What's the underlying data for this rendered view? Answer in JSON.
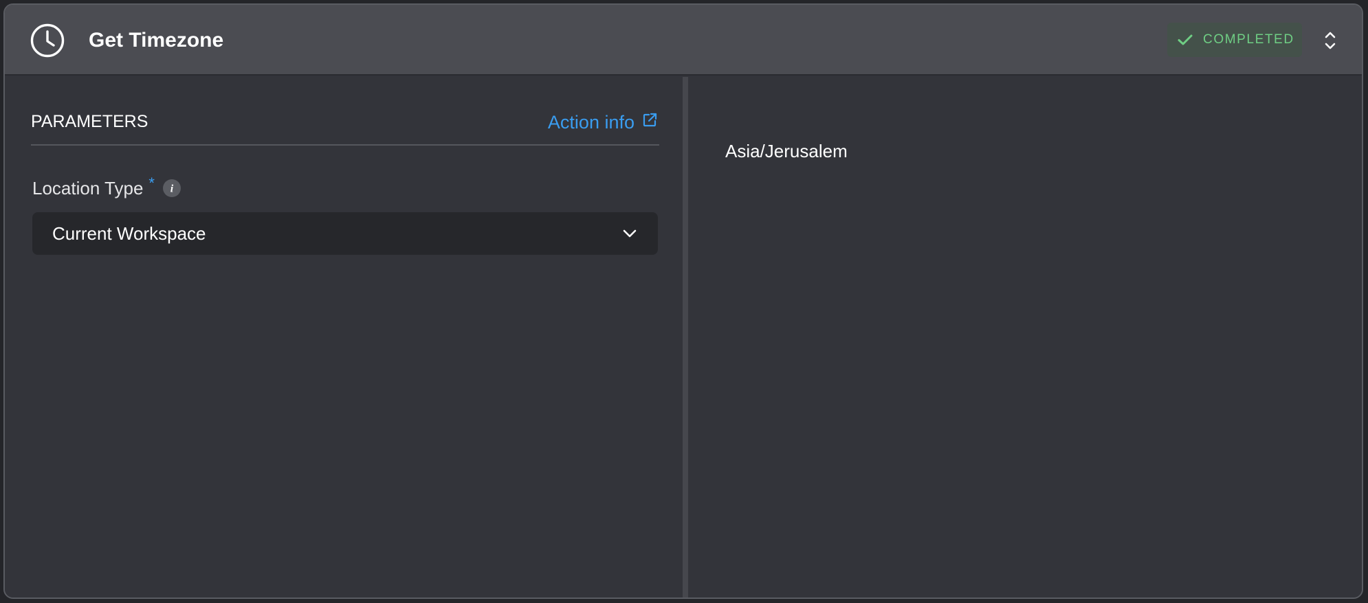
{
  "header": {
    "title": "Get Timezone",
    "icon": "clock-icon",
    "status": "COMPLETED",
    "status_icon": "check-icon",
    "toggle_icon": "expand-collapse-icon"
  },
  "parameters": {
    "title": "PARAMETERS",
    "action_info_label": "Action info",
    "action_info_icon": "external-link-icon",
    "fields": [
      {
        "label": "Location Type",
        "required_mark": "*",
        "info_icon": "i",
        "value": "Current Workspace",
        "control_icon": "chevron-down-icon"
      }
    ]
  },
  "result": {
    "value": "Asia/Jerusalem"
  },
  "colors": {
    "accent": "#3a9df0",
    "success": "#6fce84",
    "success_bg": "#44514a",
    "header_bg": "#4b4c52",
    "panel_bg": "#33343a",
    "input_bg": "#26272b"
  }
}
